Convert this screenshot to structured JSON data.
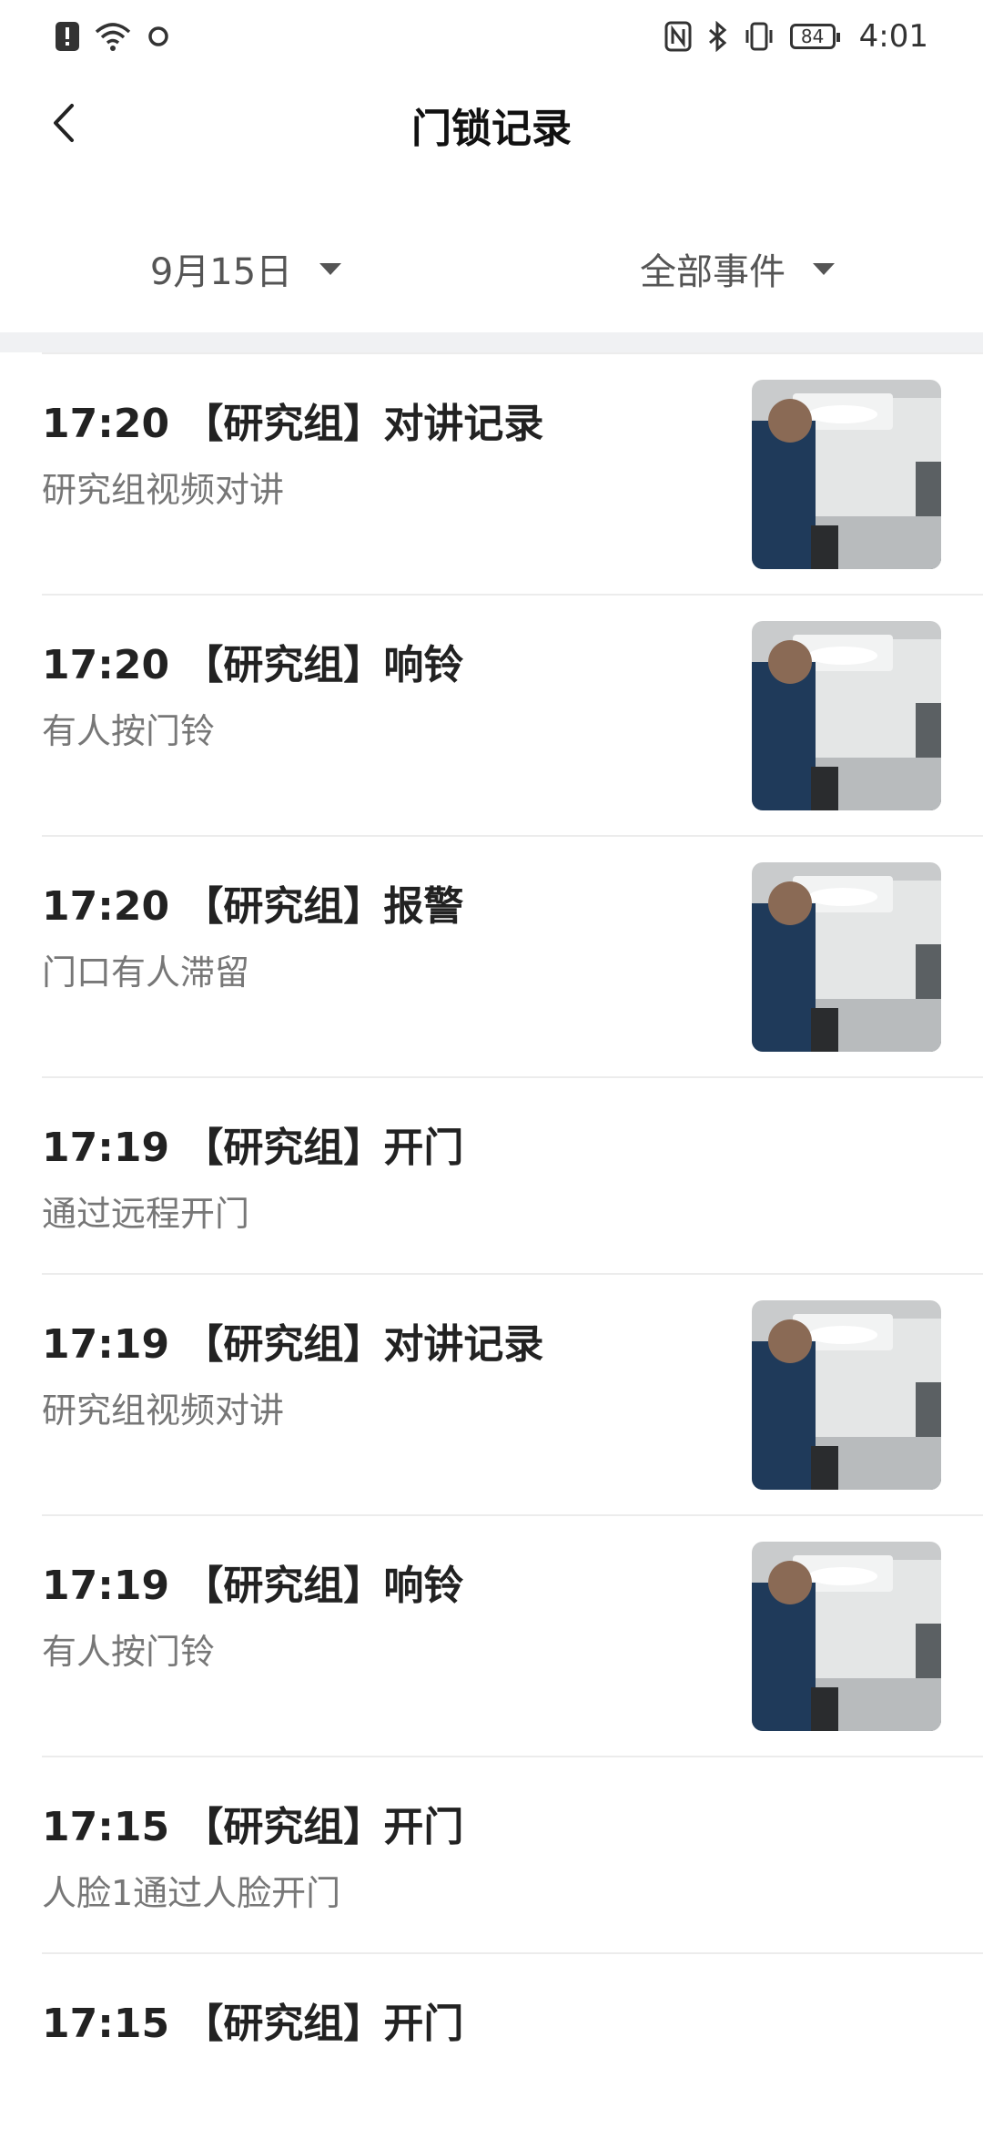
{
  "status": {
    "time": "4:01",
    "battery": "84"
  },
  "header": {
    "title": "门锁记录"
  },
  "filters": {
    "date": "9月15日",
    "events": "全部事件"
  },
  "records": [
    {
      "time": "17:20",
      "title": "【研究组】对讲记录",
      "desc": "研究组视频对讲",
      "has_image": true
    },
    {
      "time": "17:20",
      "title": "【研究组】响铃",
      "desc": "有人按门铃",
      "has_image": true
    },
    {
      "time": "17:20",
      "title": "【研究组】报警",
      "desc": "门口有人滞留",
      "has_image": true
    },
    {
      "time": "17:19",
      "title": "【研究组】开门",
      "desc": "通过远程开门",
      "has_image": false
    },
    {
      "time": "17:19",
      "title": "【研究组】对讲记录",
      "desc": "研究组视频对讲",
      "has_image": true
    },
    {
      "time": "17:19",
      "title": "【研究组】响铃",
      "desc": "有人按门铃",
      "has_image": true
    },
    {
      "time": "17:15",
      "title": "【研究组】开门",
      "desc": "人脸1通过人脸开门",
      "has_image": false
    },
    {
      "time": "17:15",
      "title": "【研究组】开门",
      "desc": "",
      "has_image": false
    }
  ]
}
